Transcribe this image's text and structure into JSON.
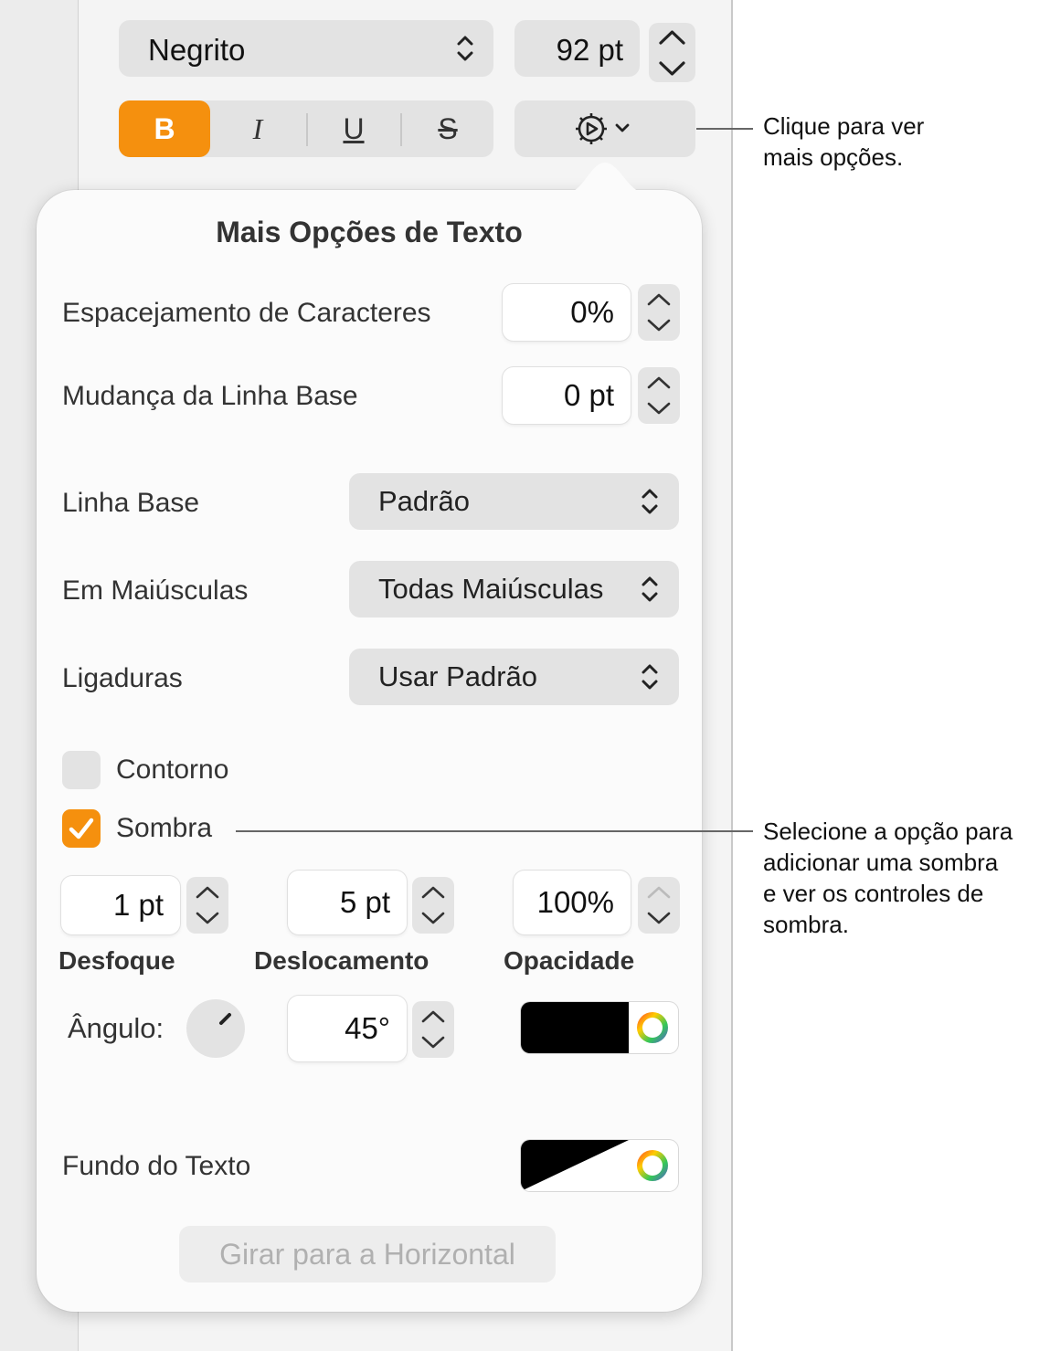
{
  "toolbar": {
    "font_style": "Negrito",
    "font_size": "92 pt",
    "bold_label": "B",
    "italic_label": "I",
    "underline_label": "U",
    "strike_label": "S"
  },
  "popover": {
    "title": "Mais Opções de Texto",
    "char_spacing": {
      "label": "Espacejamento de Caracteres",
      "value": "0%"
    },
    "baseline_shift": {
      "label": "Mudança da Linha Base",
      "value": "0 pt"
    },
    "baseline": {
      "label": "Linha Base",
      "value": "Padrão"
    },
    "capitalization": {
      "label": "Em Maiúsculas",
      "value": "Todas Maiúsculas"
    },
    "ligatures": {
      "label": "Ligaduras",
      "value": "Usar Padrão"
    },
    "outline": {
      "label": "Contorno",
      "checked": false
    },
    "shadow": {
      "label": "Sombra",
      "checked": true,
      "blur": {
        "value": "1 pt",
        "label": "Desfoque"
      },
      "offset": {
        "value": "5 pt",
        "label": "Deslocamento"
      },
      "opacity": {
        "value": "100%",
        "label": "Opacidade"
      },
      "angle_label": "Ângulo:",
      "angle_value": "45°",
      "color": "#000000"
    },
    "text_background": {
      "label": "Fundo do Texto"
    },
    "rotate_button": "Girar para a Horizontal"
  },
  "callouts": {
    "more_options": [
      "Clique para ver",
      "mais opções."
    ],
    "shadow": [
      "Selecione a opção para",
      "adicionar uma sombra",
      "e ver os controles de",
      "sombra."
    ]
  },
  "colors": {
    "accent": "#f5900e"
  }
}
